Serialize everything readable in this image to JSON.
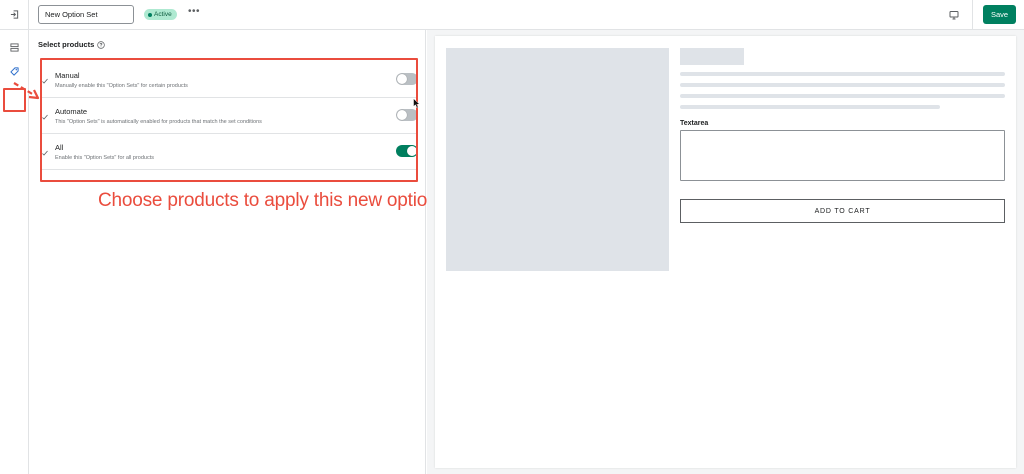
{
  "header": {
    "option_set_name": "New Option Set",
    "status_label": "Active",
    "more_label": "•••",
    "save_label": "Save"
  },
  "rail": {
    "items": [
      {
        "icon": "layout-icon"
      },
      {
        "icon": "tag-icon"
      }
    ]
  },
  "products_panel": {
    "title": "Select products",
    "options": [
      {
        "label": "Manual",
        "description": "Manually enable this \"Option Sets\" for certain products",
        "enabled": false
      },
      {
        "label": "Automate",
        "description": "This \"Option Sets\" is automatically enabled for products that match the set conditions",
        "enabled": false
      },
      {
        "label": "All",
        "description": "Enable this \"Option Sets\" for all products",
        "enabled": true
      }
    ]
  },
  "annotation": {
    "text": "Choose products to apply this new option element"
  },
  "preview": {
    "textarea_label": "Textarea",
    "add_to_cart_label": "ADD TO CART"
  },
  "colors": {
    "accent": "#008060",
    "annotation": "#ea4c3d",
    "badge": "#aee9d1"
  }
}
